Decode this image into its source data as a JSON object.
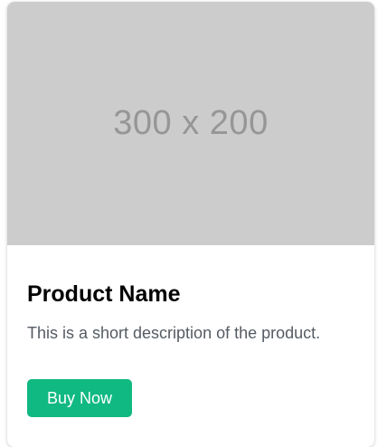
{
  "product": {
    "image_placeholder": "300 x 200",
    "name": "Product Name",
    "description": "This is a short description of the product.",
    "buy_label": "Buy Now"
  },
  "colors": {
    "accent": "#10b981",
    "image_bg": "#cccccc",
    "image_text": "#969696",
    "description_text": "#555b63"
  }
}
